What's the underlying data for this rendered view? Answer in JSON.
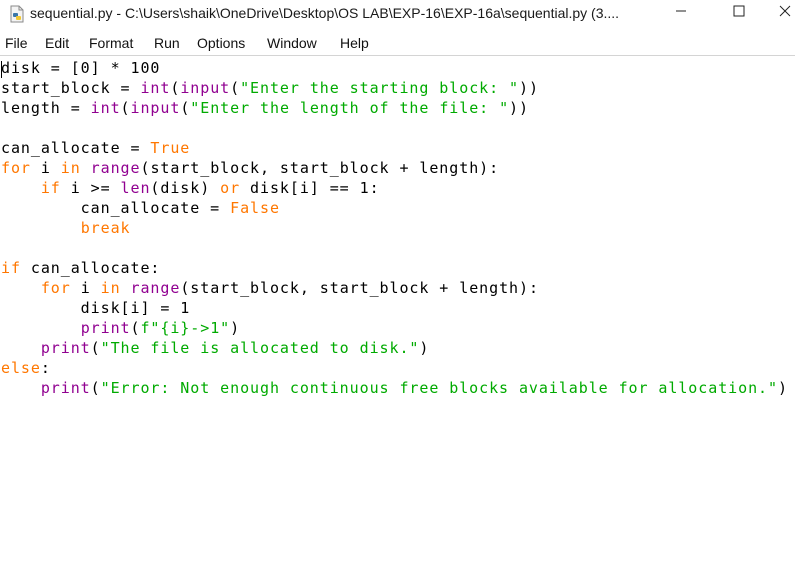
{
  "window": {
    "title": "sequential.py - C:\\Users\\shaik\\OneDrive\\Desktop\\OS LAB\\EXP-16\\EXP-16a\\sequential.py (3...."
  },
  "icons": {
    "app": "python-file-icon",
    "minimize": "minimize-icon",
    "maximize": "maximize-icon",
    "close": "close-icon"
  },
  "menu": [
    "File",
    "Edit",
    "Format",
    "Run",
    "Options",
    "Window",
    "Help"
  ],
  "colors": {
    "keyword": "#ff7700",
    "builtin": "#900090",
    "string": "#00aa00",
    "text": "#000000"
  },
  "code": [
    [
      [
        "t",
        "disk = [0] * 100"
      ]
    ],
    [
      [
        "t",
        "start_block = "
      ],
      [
        "bi",
        "int"
      ],
      [
        "t",
        "("
      ],
      [
        "bi",
        "input"
      ],
      [
        "t",
        "("
      ],
      [
        "st",
        "\"Enter the starting block: \""
      ],
      [
        "t",
        "))"
      ]
    ],
    [
      [
        "t",
        "length = "
      ],
      [
        "bi",
        "int"
      ],
      [
        "t",
        "("
      ],
      [
        "bi",
        "input"
      ],
      [
        "t",
        "("
      ],
      [
        "st",
        "\"Enter the length of the file: \""
      ],
      [
        "t",
        "))"
      ]
    ],
    [
      [
        "t",
        ""
      ]
    ],
    [
      [
        "t",
        "can_allocate = "
      ],
      [
        "kw",
        "True"
      ]
    ],
    [
      [
        "kw",
        "for"
      ],
      [
        "t",
        " i "
      ],
      [
        "kw",
        "in"
      ],
      [
        "t",
        " "
      ],
      [
        "bi",
        "range"
      ],
      [
        "t",
        "(start_block, start_block + length):"
      ]
    ],
    [
      [
        "t",
        "    "
      ],
      [
        "kw",
        "if"
      ],
      [
        "t",
        " i >= "
      ],
      [
        "bi",
        "len"
      ],
      [
        "t",
        "(disk) "
      ],
      [
        "kw",
        "or"
      ],
      [
        "t",
        " disk[i] == 1:"
      ]
    ],
    [
      [
        "t",
        "        can_allocate = "
      ],
      [
        "kw",
        "False"
      ]
    ],
    [
      [
        "t",
        "        "
      ],
      [
        "kw",
        "break"
      ]
    ],
    [
      [
        "t",
        ""
      ]
    ],
    [
      [
        "kw",
        "if"
      ],
      [
        "t",
        " can_allocate:"
      ]
    ],
    [
      [
        "t",
        "    "
      ],
      [
        "kw",
        "for"
      ],
      [
        "t",
        " i "
      ],
      [
        "kw",
        "in"
      ],
      [
        "t",
        " "
      ],
      [
        "bi",
        "range"
      ],
      [
        "t",
        "(start_block, start_block + length):"
      ]
    ],
    [
      [
        "t",
        "        disk[i] = 1"
      ]
    ],
    [
      [
        "t",
        "        "
      ],
      [
        "bi",
        "print"
      ],
      [
        "t",
        "("
      ],
      [
        "st",
        "f\"{i}->1\""
      ],
      [
        "t",
        ")"
      ]
    ],
    [
      [
        "t",
        "    "
      ],
      [
        "bi",
        "print"
      ],
      [
        "t",
        "("
      ],
      [
        "st",
        "\"The file is allocated to disk.\""
      ],
      [
        "t",
        ")"
      ]
    ],
    [
      [
        "kw",
        "else"
      ],
      [
        "t",
        ":"
      ]
    ],
    [
      [
        "t",
        "    "
      ],
      [
        "bi",
        "print"
      ],
      [
        "t",
        "("
      ],
      [
        "st",
        "\"Error: Not enough continuous free blocks available for allocation.\""
      ],
      [
        "t",
        ")"
      ]
    ]
  ]
}
